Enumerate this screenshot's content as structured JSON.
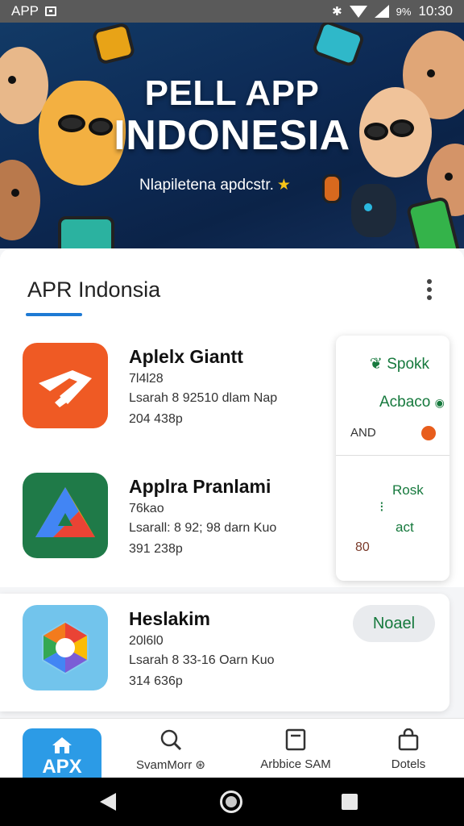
{
  "status_bar": {
    "app_label": "APP",
    "battery": "9%",
    "time": "10:30"
  },
  "banner": {
    "title_line1": "PELL APP",
    "title_line2": "INDONESIA",
    "subtitle": "Nlapiletena apdcstr."
  },
  "section": {
    "title": "APR Indonsia"
  },
  "apps": [
    {
      "name": "Aplelx Giantt",
      "line1": "7Ɩ4Ɩ28",
      "line2": "Lsarah 8 92510 dlam Nap",
      "line3": "204 438p"
    },
    {
      "name": "Applra Pranlami",
      "line1": "76kao",
      "line2": "Lsarall: 8 92; 98 darn Kuo",
      "line3": "391 238p"
    },
    {
      "name": "Heslakim",
      "line1": "20Ɩ6Ɩ0",
      "line2": "Lsarah 8 33-16 Oarn Kuo",
      "line3": "314 636p"
    }
  ],
  "side_panel": {
    "top_label1": "Spokk",
    "top_label2": "Acbaco",
    "top_label3": "AND",
    "bottom_label1": "Rosk",
    "bottom_label2": "act",
    "bottom_label3": "80"
  },
  "install_button": "Noael",
  "bottom_nav": {
    "home_label": "APX",
    "search_label": "SvamMorr",
    "archive_label": "Arbbice SAM",
    "bag_label": "Dotels"
  },
  "colors": {
    "accent_blue": "#2c9be6",
    "underline_blue": "#1e7ad4",
    "green_text": "#16793d",
    "app1_orange": "#ef5a24"
  }
}
